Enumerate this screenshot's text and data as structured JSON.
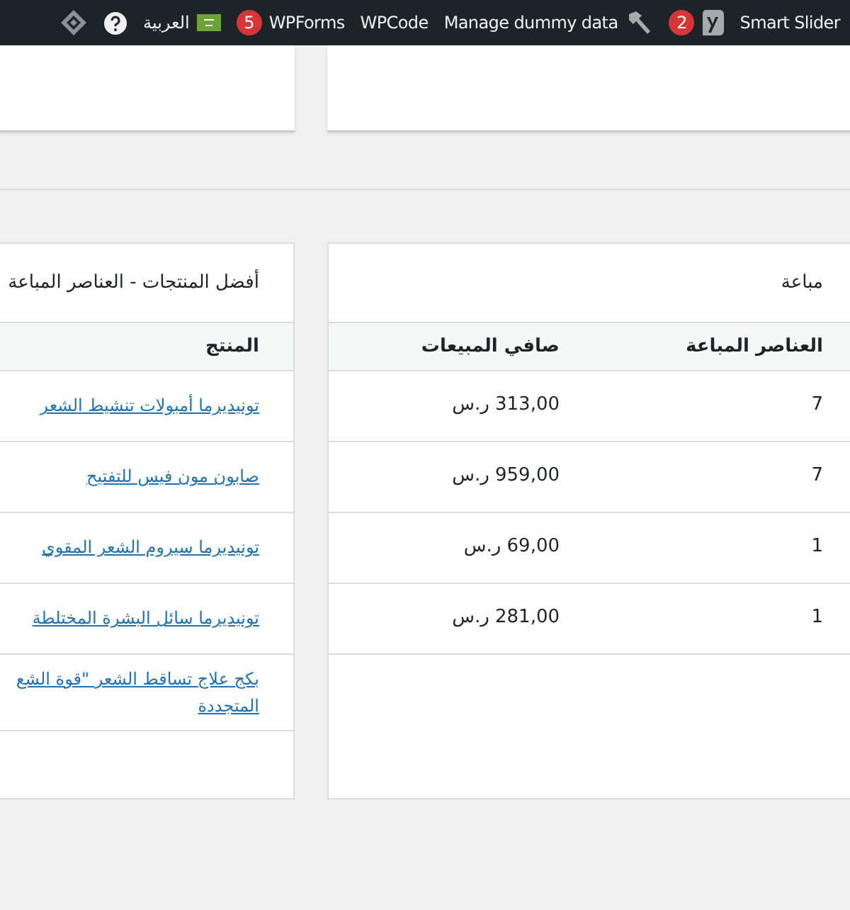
{
  "admin_bar": {
    "items": [
      {
        "kind": "menu",
        "label": "Smart Slider"
      },
      {
        "kind": "seo",
        "badge": "2"
      },
      {
        "kind": "tool",
        "label": "Manage dummy data"
      },
      {
        "kind": "menu",
        "label": "WPCode"
      },
      {
        "kind": "menu",
        "label": "WPForms",
        "badge": "5"
      },
      {
        "kind": "language",
        "label": "العربية"
      },
      {
        "kind": "help"
      },
      {
        "kind": "logo"
      }
    ]
  },
  "panels": [
    {
      "title": "مباعة",
      "columns": [
        {
          "label": "العناصر المباعة"
        },
        {
          "label": "صافي المبيعات"
        }
      ],
      "rows": [
        {
          "cells": [
            {
              "kind": "text",
              "lines": [
                "7"
              ]
            },
            {
              "kind": "text",
              "lines": [
                "313,00 ر.س"
              ]
            }
          ]
        },
        {
          "cells": [
            {
              "kind": "text",
              "lines": [
                "7"
              ]
            },
            {
              "kind": "text",
              "lines": [
                "959,00 ر.س"
              ]
            }
          ]
        },
        {
          "cells": [
            {
              "kind": "text",
              "lines": [
                "1"
              ]
            },
            {
              "kind": "text",
              "lines": [
                "69,00 ر.س"
              ]
            }
          ]
        },
        {
          "cells": [
            {
              "kind": "text",
              "lines": [
                "1"
              ]
            },
            {
              "kind": "text",
              "lines": [
                "281,00 ر.س"
              ]
            }
          ]
        }
      ]
    },
    {
      "title": "أفضل المنتجات - العناصر المباعة",
      "columns": [
        {
          "label": "المنتج"
        }
      ],
      "rows": [
        {
          "cells": [
            {
              "kind": "link",
              "lines": [
                "تونيديرما أمبولات تنشيط الشعر"
              ]
            }
          ]
        },
        {
          "cells": [
            {
              "kind": "link",
              "lines": [
                "صابون مون فيس للتفتيح"
              ]
            }
          ]
        },
        {
          "cells": [
            {
              "kind": "link",
              "lines": [
                "تونيديرما سيروم الشعر المقوي"
              ]
            }
          ]
        },
        {
          "cells": [
            {
              "kind": "link",
              "lines": [
                "تونيديرما سائل البشرة المختلطة"
              ]
            }
          ]
        },
        {
          "cells": [
            {
              "kind": "link",
              "lines": [
                "بكج علاج تساقط الشعر \"قوة الشع",
                "المتجددة"
              ]
            }
          ]
        }
      ]
    }
  ]
}
